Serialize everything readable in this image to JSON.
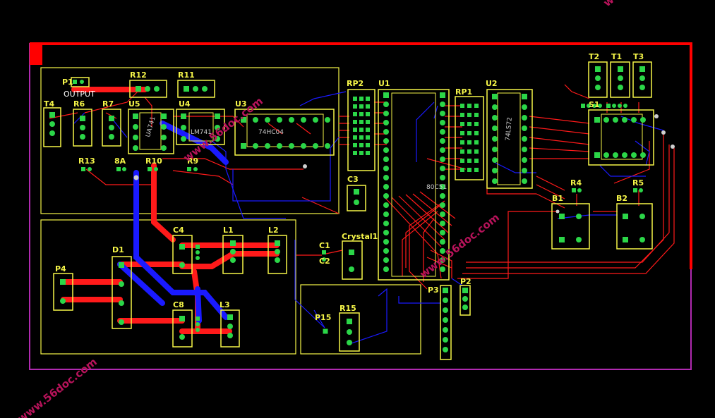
{
  "board": {
    "colors": {
      "background": "#000000",
      "top_copper": "#ff1a1a",
      "bottom_copper": "#1a1aff",
      "silkscreen": "#f5f548",
      "pad": "#2bd648",
      "via": "#cfcfcf",
      "outline": "#b02ab0",
      "keepout": "#ff0000"
    },
    "watermark": "www.56doc.com",
    "labels": {
      "p1": "P1",
      "p1_value": "OUTPUT",
      "r12": "R12",
      "r11": "R11",
      "t4": "T4",
      "r6": "R6",
      "r7": "R7",
      "u5": "U5",
      "u4": "U4",
      "u3": "U3",
      "r13": "R13",
      "r10": "R10",
      "r9": "R9",
      "r8": "8A",
      "rp2": "RP2",
      "u1": "U1",
      "rp1": "RP1",
      "u2": "U2",
      "t2": "T2",
      "t1": "T1",
      "t3": "T3",
      "s1": "S1",
      "c3": "C3",
      "r4": "R4",
      "r5": "R5",
      "b1": "B1",
      "b2": "B2",
      "c4": "C4",
      "l1": "L1",
      "l2": "L2",
      "c1": "C1",
      "c2": "C2",
      "crystal": "Crystal1",
      "d1": "D1",
      "p4": "P4",
      "c8": "C8",
      "l3": "L3",
      "r15": "R15",
      "p15": "P15",
      "p3": "P3",
      "p2": "P2"
    },
    "chip_values": {
      "u1": "80C51",
      "u3": "74HC04",
      "u4": "LM741",
      "u5": "UA741",
      "u2": "74LS72"
    }
  }
}
